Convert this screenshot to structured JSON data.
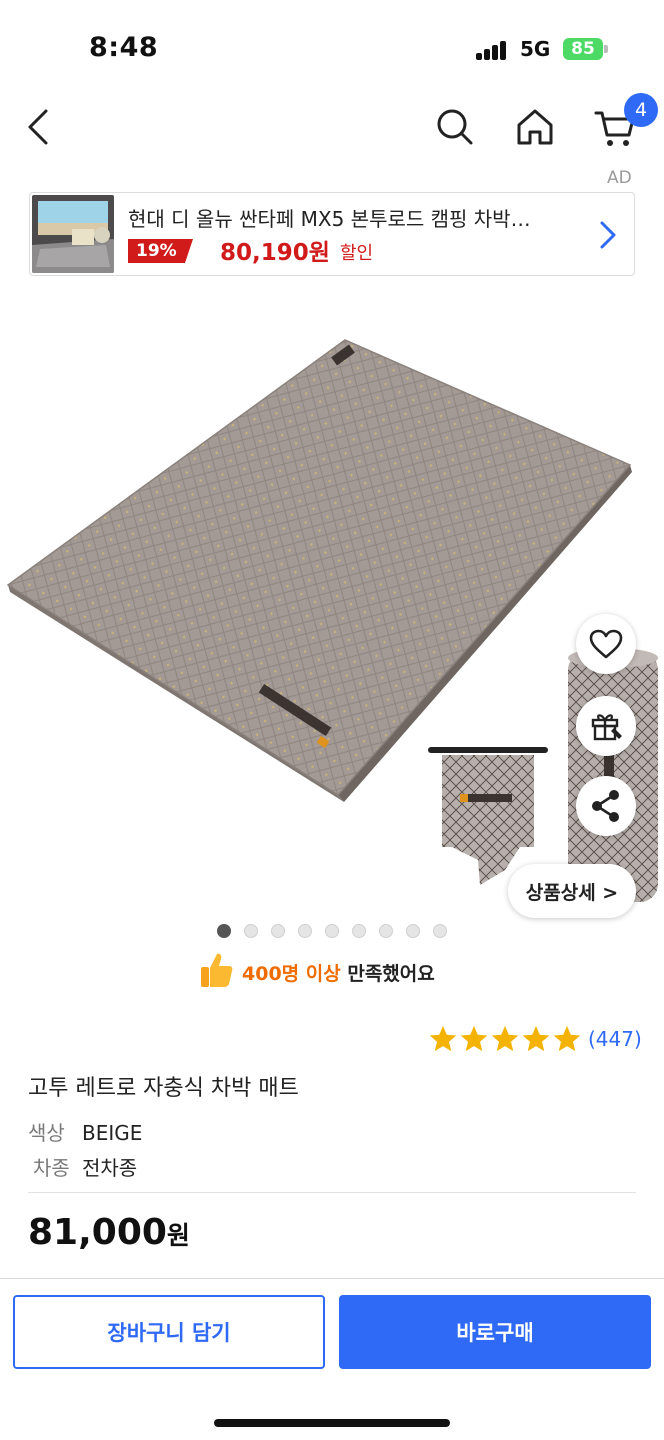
{
  "status_bar": {
    "time": "8:48",
    "network": "5G",
    "battery": "85",
    "icons": [
      "cellular-signal-icon",
      "battery-charging-icon"
    ]
  },
  "nav": {
    "icons": [
      "back-chevron-icon",
      "search-icon",
      "home-icon",
      "cart-icon"
    ],
    "cart_count": "4"
  },
  "ad": {
    "label": "AD",
    "title": "현대 디 올뉴 싼타페 MX5 본투로드 캠핑 차박…",
    "discount": "19%",
    "price": "80,190원",
    "sale_text": "할인",
    "icons": [
      "chevron-right-icon"
    ]
  },
  "gallery": {
    "dot_count": 9,
    "active_index": 0,
    "side_icons": [
      "heart-icon",
      "gift-icon",
      "share-icon"
    ],
    "detail_button": "상품상세 >"
  },
  "satisfaction": {
    "icon": "thumbs-up-icon",
    "highlight": "400명 이상",
    "text": " 만족했어요"
  },
  "product": {
    "rating_stars": 5,
    "review_count": "(447)",
    "name": "고투 레트로 자충식 차박 매트",
    "options": [
      {
        "label": "색상",
        "value": "BEIGE"
      },
      {
        "label": "차종",
        "value": "전차종"
      }
    ],
    "price": "81,000",
    "price_unit": "원"
  },
  "actions": {
    "cart": "장바구니 담기",
    "buy": "바로구매"
  },
  "colors": {
    "accent": "#2f6af6",
    "sale_red": "#d11a1a",
    "highlight_orange": "#ef6c00",
    "star_gold": "#f5b301"
  }
}
